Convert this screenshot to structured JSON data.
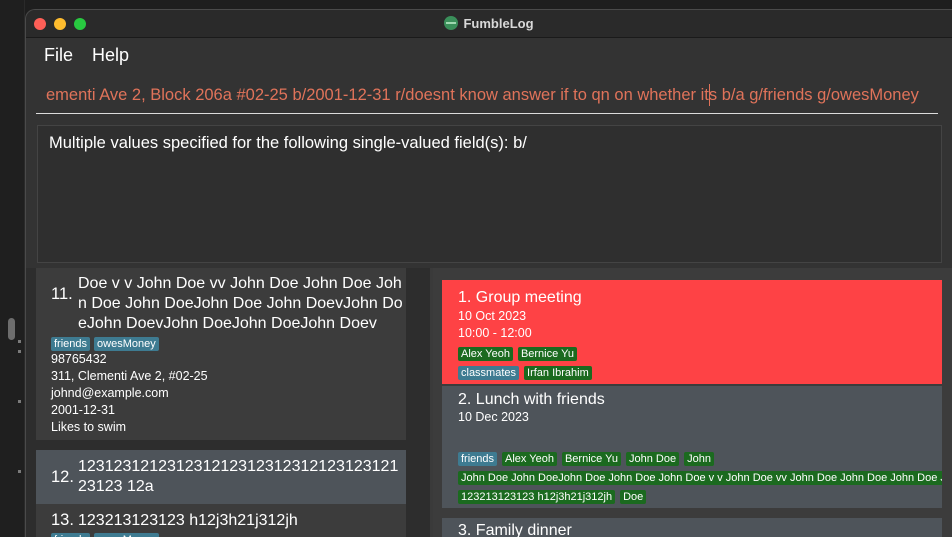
{
  "window": {
    "title": "FumbleLog"
  },
  "menu": {
    "file": "File",
    "help": "Help"
  },
  "command": {
    "value": "ementi Ave 2, Block 206a #02-25 b/2001-12-31 r/doesnt know answer  if to qn on whether its b/a g/friends g/owesMoney"
  },
  "result": {
    "text": "Multiple values specified for the following single-valued field(s): b/"
  },
  "persons": [
    {
      "index": "11.",
      "name": "Doe v v John Doe vv John Doe John Doe John Doe John DoeJohn Doe John DoevJohn DoeJohn DoevJohn DoeJohn DoeJohn Doev",
      "tags": [
        "friends",
        "owesMoney"
      ],
      "phone": "98765432",
      "address": "311, Clementi Ave 2, #02-25",
      "email": "johnd@example.com",
      "birthday": "2001-12-31",
      "remark": "Likes to swim"
    },
    {
      "index": "12.",
      "name": "12312312123123121231231231212312312123123 12a"
    },
    {
      "index": "13.",
      "name": "123213123123 h12j3h21j312jh",
      "tags": [
        "friends",
        "owesMoney"
      ]
    }
  ],
  "events": [
    {
      "title": "1.  Group meeting",
      "date": "10 Oct 2023",
      "time": "10:00 - 12:00",
      "row1": [
        "Alex Yeoh",
        "Bernice Yu"
      ],
      "row2": [
        {
          "text": "classmates",
          "kind": "group"
        },
        {
          "text": "Irfan Ibrahim",
          "kind": "person"
        }
      ]
    },
    {
      "title": "2.  Lunch with friends",
      "date": "10 Dec 2023",
      "row1": [
        {
          "text": "friends",
          "kind": "group"
        },
        {
          "text": "Alex Yeoh",
          "kind": "person"
        },
        {
          "text": "Bernice Yu",
          "kind": "person"
        },
        {
          "text": "John Doe",
          "kind": "person"
        },
        {
          "text": "John",
          "kind": "person"
        }
      ],
      "row2": "John Doe John DoeJohn Doe John Doe John Doe v v John Doe vv John Doe John Doe John Doe John Doe John Doe",
      "row3": [
        "123213123123 h12j3h21j312jh",
        "Doe"
      ]
    },
    {
      "title": "3.  Family dinner"
    }
  ],
  "colors": {
    "accent_red": "#fe4245",
    "tag_blue": "#3e7b91",
    "tag_green": "#1b6a1f",
    "command_text": "#e0735a"
  }
}
